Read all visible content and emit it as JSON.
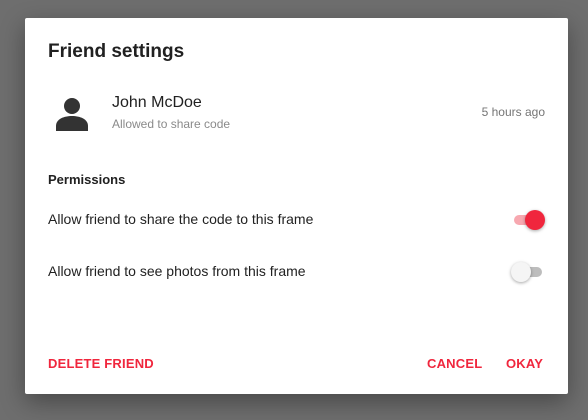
{
  "dialog": {
    "title": "Friend settings",
    "user": {
      "name": "John McDoe",
      "subtitle": "Allowed to share code",
      "time": "5 hours ago",
      "avatar_icon": "person-icon"
    },
    "permissions": {
      "label": "Permissions",
      "items": [
        {
          "label": "Allow friend to share the code to this frame",
          "enabled": true
        },
        {
          "label": "Allow friend to see photos from this frame",
          "enabled": false
        }
      ]
    },
    "actions": {
      "delete": "DELETE FRIEND",
      "cancel": "CANCEL",
      "okay": "OKAY"
    }
  },
  "colors": {
    "accent": "#f0263d",
    "accent_track": "#f7a8b0",
    "scrim": "#6e6e6e",
    "surface": "#ffffff"
  }
}
